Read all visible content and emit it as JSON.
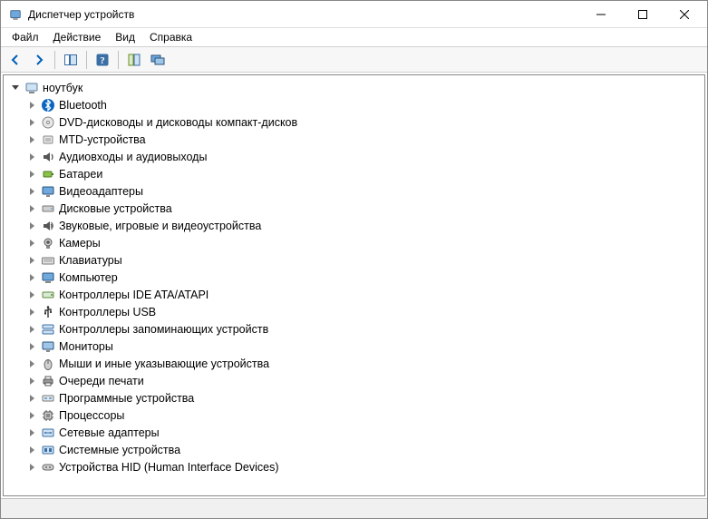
{
  "window": {
    "title": "Диспетчер устройств"
  },
  "menu": {
    "file": "Файл",
    "action": "Действие",
    "view": "Вид",
    "help": "Справка"
  },
  "toolbar_icons": {
    "back": "back-icon",
    "forward": "forward-icon",
    "show_hide": "show-hide-tree-icon",
    "help": "help-icon",
    "properties": "properties-icon",
    "monitors": "monitors-icon"
  },
  "tree": {
    "root": {
      "label": "ноутбук",
      "expanded": true
    },
    "items": [
      {
        "label": "Bluetooth",
        "icon": "bluetooth"
      },
      {
        "label": "DVD-дисководы и дисководы компакт-дисков",
        "icon": "dvd"
      },
      {
        "label": "MTD-устройства",
        "icon": "mtd"
      },
      {
        "label": "Аудиовходы и аудиовыходы",
        "icon": "audio"
      },
      {
        "label": "Батареи",
        "icon": "battery"
      },
      {
        "label": "Видеоадаптеры",
        "icon": "display"
      },
      {
        "label": "Дисковые устройства",
        "icon": "disk"
      },
      {
        "label": "Звуковые, игровые и видеоустройства",
        "icon": "sound"
      },
      {
        "label": "Камеры",
        "icon": "camera"
      },
      {
        "label": "Клавиатуры",
        "icon": "keyboard"
      },
      {
        "label": "Компьютер",
        "icon": "computer"
      },
      {
        "label": "Контроллеры IDE ATA/ATAPI",
        "icon": "ide"
      },
      {
        "label": "Контроллеры USB",
        "icon": "usb"
      },
      {
        "label": "Контроллеры запоминающих устройств",
        "icon": "storage"
      },
      {
        "label": "Мониторы",
        "icon": "monitor"
      },
      {
        "label": "Мыши и иные указывающие устройства",
        "icon": "mouse"
      },
      {
        "label": "Очереди печати",
        "icon": "printer"
      },
      {
        "label": "Программные устройства",
        "icon": "software"
      },
      {
        "label": "Процессоры",
        "icon": "cpu"
      },
      {
        "label": "Сетевые адаптеры",
        "icon": "network"
      },
      {
        "label": "Системные устройства",
        "icon": "system"
      },
      {
        "label": "Устройства HID (Human Interface Devices)",
        "icon": "hid"
      }
    ]
  },
  "status": ""
}
